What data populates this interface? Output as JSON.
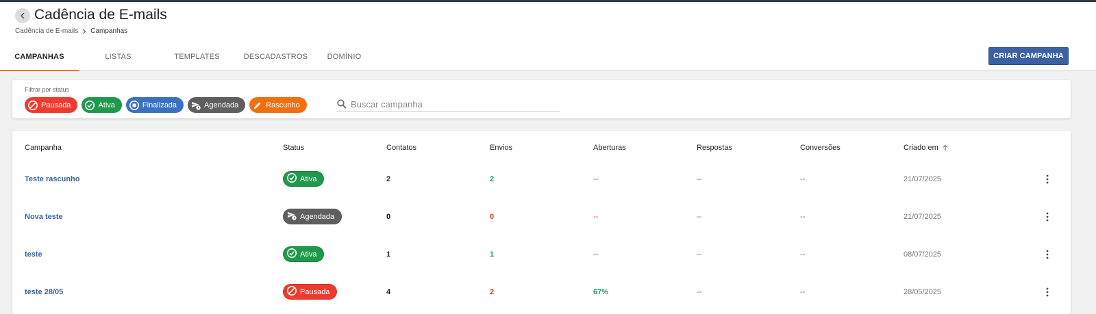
{
  "header": {
    "title": "Cadência de E-mails",
    "breadcrumb": [
      "Cadência de E-mails",
      "Campanhas"
    ]
  },
  "tabs": [
    {
      "label": "CAMPANHAS",
      "active": true
    },
    {
      "label": "LISTAS",
      "active": false
    },
    {
      "label": "TEMPLATES",
      "active": false
    },
    {
      "label": "DESCADASTROS",
      "active": false
    },
    {
      "label": "DOMÍNIO",
      "active": false
    }
  ],
  "create_button": "CRIAR CAMPANHA",
  "filter": {
    "label": "Filtrar por status",
    "chips": [
      {
        "label": "Pausada",
        "icon": "block-icon",
        "color": "#ef3b2f"
      },
      {
        "label": "Ativa",
        "icon": "check-circle-icon",
        "color": "#1f9a4c"
      },
      {
        "label": "Finalizada",
        "icon": "stop-circle-icon",
        "color": "#3a72c0"
      },
      {
        "label": "Agendada",
        "icon": "scheduled-send-icon",
        "color": "#5f5f5f"
      },
      {
        "label": "Rascunho",
        "icon": "pencil-icon",
        "color": "#f26f0f"
      }
    ]
  },
  "search": {
    "placeholder": "Buscar campanha",
    "value": ""
  },
  "table": {
    "columns": [
      "Campanha",
      "Status",
      "Contatos",
      "Envios",
      "Aberturas",
      "Respostas",
      "Conversões",
      "Criado em"
    ],
    "sort_column": "Criado em",
    "rows": [
      {
        "name": "Teste rascunho",
        "status": "Ativa",
        "status_color": "#1f9a4c",
        "status_icon": "check-circle-icon",
        "contatos": "2",
        "envios": "2",
        "envios_color": "green",
        "aberturas": "--",
        "respostas": "--",
        "conversoes": "--",
        "criado": "21/07/2025"
      },
      {
        "name": "Nova teste",
        "status": "Agendada",
        "status_color": "#5f5f5f",
        "status_icon": "scheduled-send-icon",
        "contatos": "0",
        "envios": "0",
        "envios_color": "red",
        "aberturas": "--",
        "respostas": "--",
        "conversoes": "--",
        "criado": "21/07/2025"
      },
      {
        "name": "teste",
        "status": "Ativa",
        "status_color": "#1f9a4c",
        "status_icon": "check-circle-icon",
        "contatos": "1",
        "envios": "1",
        "envios_color": "green",
        "aberturas": "--",
        "respostas": "--",
        "conversoes": "--",
        "criado": "08/07/2025"
      },
      {
        "name": "teste 28/05",
        "status": "Pausada",
        "status_color": "#ef3b2f",
        "status_icon": "block-icon",
        "contatos": "4",
        "envios": "2",
        "envios_color": "red",
        "aberturas": "67%",
        "respostas": "--",
        "conversoes": "--",
        "criado": "28/05/2025"
      }
    ]
  },
  "colors": {
    "accent_tab": "#e8732e",
    "primary": "#3a62a3",
    "success": "#1f9a4c",
    "danger": "#e53935"
  }
}
